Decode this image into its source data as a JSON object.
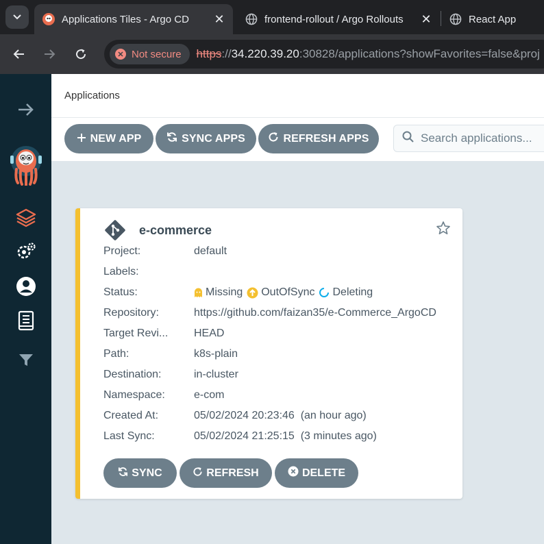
{
  "browser": {
    "tabs": [
      {
        "title": "Applications Tiles - Argo CD",
        "active": true,
        "favicon": "argo-icon"
      },
      {
        "title": "frontend-rollout / Argo Rollouts",
        "active": false,
        "favicon": "globe-icon"
      },
      {
        "title": "React App",
        "active": false,
        "favicon": "globe-icon"
      }
    ],
    "close_glyph": "✕",
    "security_label": "Not secure",
    "url": {
      "protocol": "https",
      "separator": "://",
      "host": "34.220.39.20",
      "rest": ":30828/applications?showFavorites=false&proj"
    }
  },
  "header": {
    "title": "Applications"
  },
  "actions": {
    "new_app": "NEW APP",
    "sync_apps": "SYNC APPS",
    "refresh_apps": "REFRESH APPS",
    "search_placeholder": "Search applications..."
  },
  "app": {
    "name": "e-commerce",
    "fields": {
      "project": {
        "label": "Project:",
        "value": "default"
      },
      "labels": {
        "label": "Labels:",
        "value": ""
      },
      "status": {
        "label": "Status:",
        "health": "Missing",
        "sync": "OutOfSync",
        "op": "Deleting"
      },
      "repository": {
        "label": "Repository:",
        "value": "https://github.com/faizan35/e-Commerce_ArgoCD"
      },
      "target_revision": {
        "label": "Target Revi...",
        "value": "HEAD"
      },
      "path": {
        "label": "Path:",
        "value": "k8s-plain"
      },
      "destination": {
        "label": "Destination:",
        "value": "in-cluster"
      },
      "namespace": {
        "label": "Namespace:",
        "value": "e-com"
      },
      "created_at": {
        "label": "Created At:",
        "value": "05/02/2024 20:23:46  (an hour ago)"
      },
      "last_sync": {
        "label": "Last Sync:",
        "value": "05/02/2024 21:25:15  (3 minutes ago)"
      }
    },
    "buttons": {
      "sync": "SYNC",
      "refresh": "REFRESH",
      "delete": "DELETE"
    }
  },
  "colors": {
    "sidebar": "#0f2733",
    "accent_orange": "#e96d4f",
    "tile_border_outofsync": "#f4c030",
    "button_gray": "#6d7f8b",
    "status_missing": "#f4c030",
    "status_deleting": "#0dadea"
  }
}
